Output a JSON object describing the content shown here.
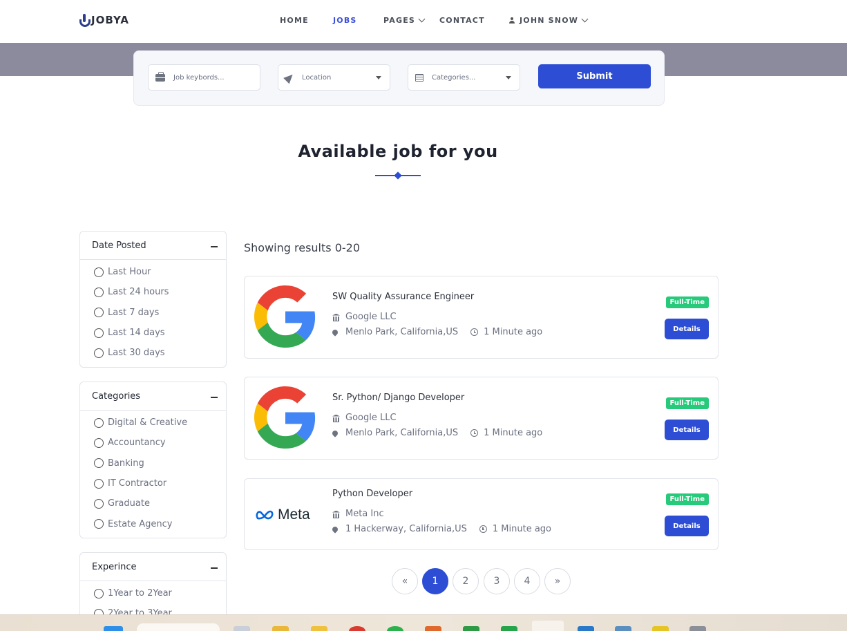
{
  "brand": {
    "name": "JOBYA"
  },
  "nav": {
    "home": "HOME",
    "jobs": "JOBS",
    "pages": "PAGES",
    "contact": "CONTACT",
    "user": "JOHN SNOW"
  },
  "search": {
    "keywords_placeholder": "Job keybords...",
    "location_placeholder": "Location",
    "categories_placeholder": "Categories...",
    "submit_label": "Submit"
  },
  "section": {
    "title": "Available job for you"
  },
  "filters": {
    "date_posted": {
      "title": "Date Posted",
      "options": [
        "Last Hour",
        "Last 24 hours",
        "Last 7 days",
        "Last 14 days",
        "Last 30 days"
      ]
    },
    "categories": {
      "title": "Categories",
      "options": [
        "Digital & Creative",
        "Accountancy",
        "Banking",
        "IT Contractor",
        "Graduate",
        "Estate Agency"
      ]
    },
    "experience": {
      "title": "Experince",
      "options": [
        "1Year to 2Year",
        "2Year to 3Year"
      ]
    }
  },
  "results": {
    "heading": "Showing results 0-20",
    "jobs": [
      {
        "title": "SW Quality Assurance Engineer",
        "company": "Google LLC",
        "location": "Menlo Park, California,US",
        "posted": "1 Minute ago",
        "type": "Full-Time",
        "action": "Details",
        "logo": "google-logo"
      },
      {
        "title": "Sr. Python/ Django Developer",
        "company": "Google LLC",
        "location": "Menlo Park, California,US",
        "posted": "1 Minute ago",
        "type": "Full-Time",
        "action": "Details",
        "logo": "google-logo"
      },
      {
        "title": "Python Developer",
        "company": "Meta Inc",
        "location": "1 Hackerway, California,US",
        "posted": "1 Minute ago",
        "type": "Full-Time",
        "action": "Details",
        "logo": "meta-logo",
        "logo_text": "Meta"
      }
    ]
  },
  "pagination": {
    "prev": "«",
    "pages": [
      "1",
      "2",
      "3",
      "4"
    ],
    "current": "1",
    "next": "»"
  },
  "colors": {
    "accent": "#2d4ed4",
    "badge": "#27c97b",
    "hero_band": "#8b8b9d"
  }
}
